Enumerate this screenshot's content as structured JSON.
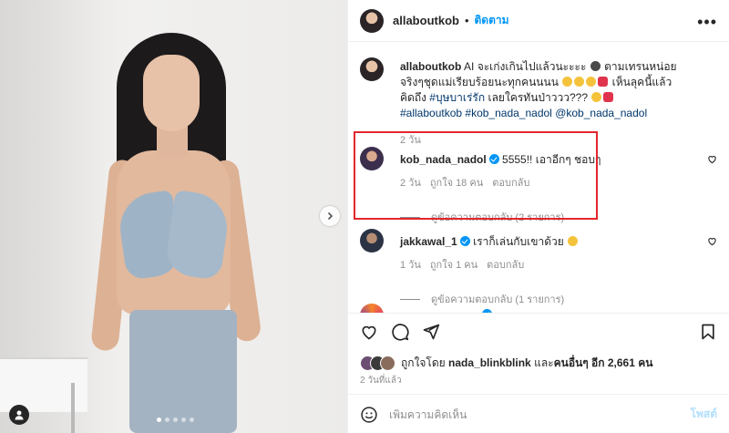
{
  "post": {
    "username": "allaboutkob",
    "follow_label": "ติดตาม",
    "more_icon": "more-horizontal-icon",
    "caption": {
      "username": "allaboutkob",
      "text_1": "AI จะเก่งเกินไปแล้วนะะะะ",
      "text_2": "ตามเทรนหน่อย จริงๆชุดแม่เรียบร้อยนะทุกคนนนน",
      "text_3": "เห็นลุคนี้แล้วคิดถึง",
      "hashtag_1": "#บุษบาเร่รัก",
      "text_4": "เลยใครทันป่าววว???",
      "hashtag_2": "#allaboutkob",
      "hashtag_3": "#kob_nada_nadol",
      "mention": "@kob_nada_nadol",
      "time": "2 วัน"
    },
    "comments": [
      {
        "username": "kob_nada_nadol",
        "text": "5555!! เอาอีกๆ ชอบๆ",
        "time": "2 วัน",
        "likes": "ถูกใจ 18 คน",
        "reply": "ตอบกลับ",
        "view_replies": "ดูข้อความตอบกลับ (2 รายการ)"
      },
      {
        "username": "jakkawal_1",
        "text": "เราก็เล่นกับเขาด้วย",
        "time": "1 วัน",
        "likes": "ถูกใจ 1 คน",
        "reply": "ตอบกลับ",
        "view_replies": "ดูข้อความตอบกลับ (1 รายการ)"
      }
    ],
    "liked_by": {
      "prefix": "ถูกใจโดย",
      "user": "nada_blinkblink",
      "middle": "และ",
      "others": "คนอื่นๆ อีก 2,661 คน"
    },
    "posted_ago": "2 วันที่แล้ว",
    "comment_placeholder": "เพิ่มความคิดเห็น",
    "post_button": "โพสต์"
  },
  "colors": {
    "accent": "#0095f6",
    "highlight_box": "#e3262c",
    "muted": "#8e8e8e"
  }
}
